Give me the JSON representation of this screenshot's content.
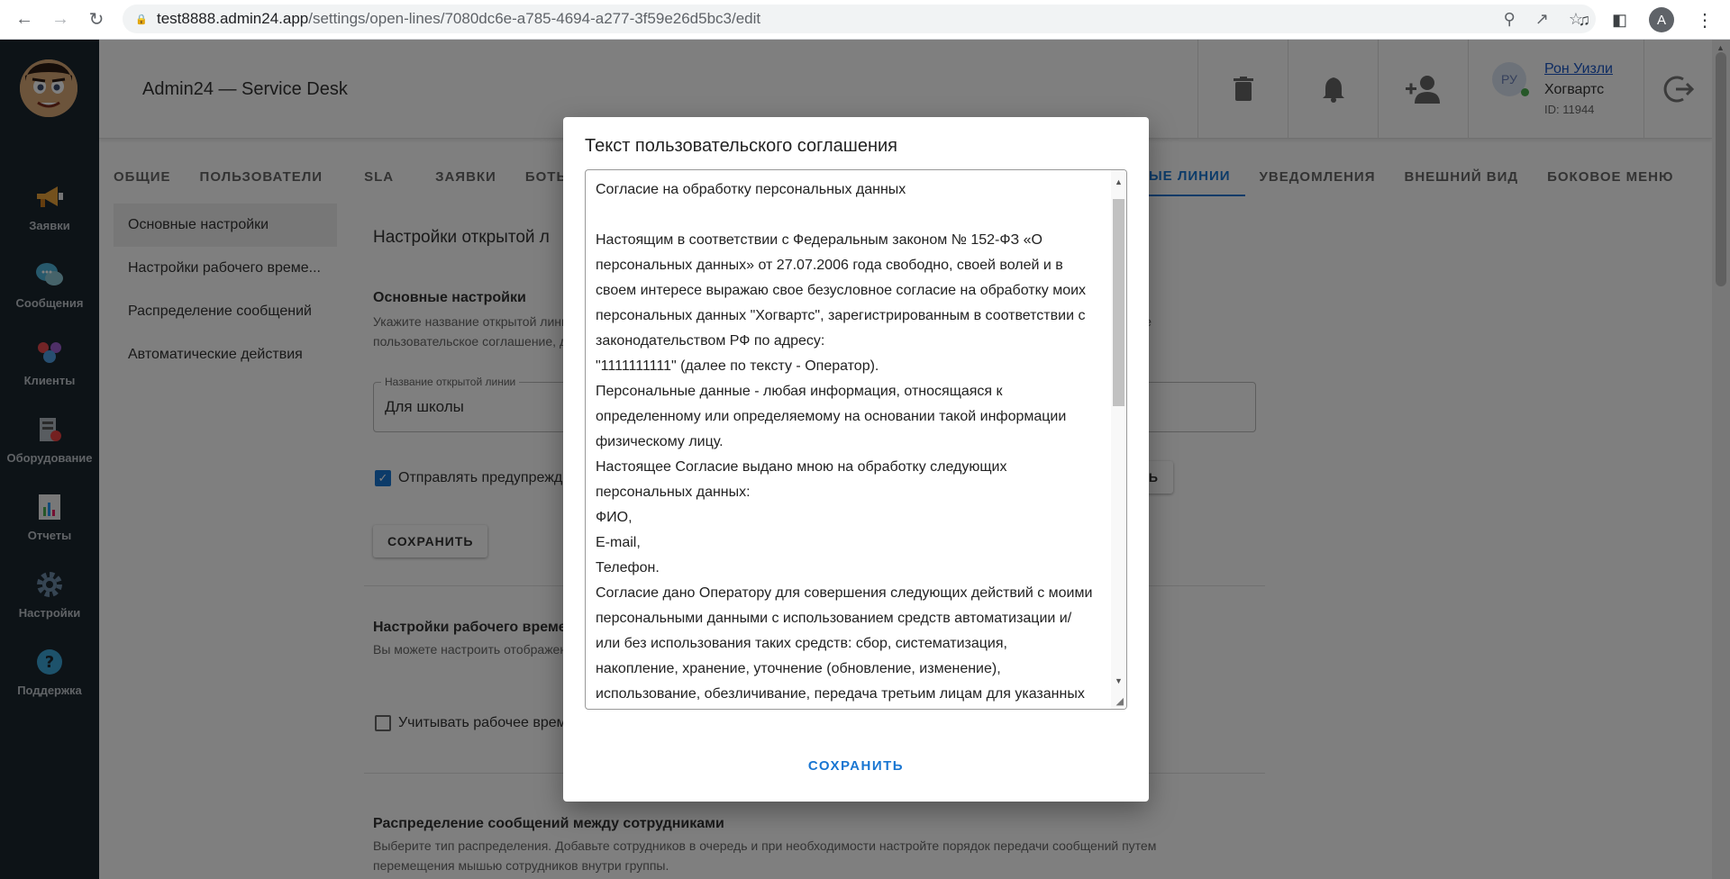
{
  "browser": {
    "url_host": "test8888.admin24.app",
    "url_path": "/settings/open-lines/7080dc6e-a785-4694-a277-3f59e26d5bc3/edit",
    "profile_initial": "A"
  },
  "sidebar": {
    "items": [
      {
        "label": "Заявки",
        "icon": "megaphone-icon"
      },
      {
        "label": "Сообщения",
        "icon": "chat-icon"
      },
      {
        "label": "Клиенты",
        "icon": "clients-icon"
      },
      {
        "label": "Оборудование",
        "icon": "equipment-icon"
      },
      {
        "label": "Отчеты",
        "icon": "reports-icon"
      },
      {
        "label": "Настройки",
        "icon": "gear-icon"
      },
      {
        "label": "Поддержка",
        "icon": "help-icon"
      }
    ]
  },
  "header": {
    "title": "Admin24 — Service Desk",
    "user": {
      "initials": "РУ",
      "name": "Рон Уизли",
      "org": "Хогвартс",
      "id": "ID: 11944"
    }
  },
  "tabs": [
    {
      "label": "ОБЩИЕ",
      "active": false
    },
    {
      "label": "ПОЛЬЗОВАТЕЛИ",
      "active": false
    },
    {
      "label": "SLA",
      "active": false
    },
    {
      "label": "ЗАЯВКИ",
      "active": false
    },
    {
      "label": "БОТЫ",
      "active": false
    },
    {
      "label": "",
      "active": false
    },
    {
      "label": "ОТКРЫТЫЕ ЛИНИИ",
      "active": true
    },
    {
      "label": "УВЕДОМЛЕНИЯ",
      "active": false
    },
    {
      "label": "ВНЕШНИЙ ВИД",
      "active": false
    },
    {
      "label": "БОКОВОЕ МЕНЮ",
      "active": false
    }
  ],
  "subnav": [
    {
      "label": "Основные настройки",
      "active": true
    },
    {
      "label": "Настройки рабочего време...",
      "active": false
    },
    {
      "label": "Распределение сообщений",
      "active": false
    },
    {
      "label": "Автоматические действия",
      "active": false
    }
  ],
  "content": {
    "section_title": "Настройки открытой л",
    "basic_title": "Основные настройки",
    "basic_desc_1": "Укажите название открытой лини",
    "basic_desc_1_tail": "те",
    "basic_desc_2": "пользовательское соглашение, д",
    "field_label": "Название открытой линии",
    "field_value": "Для школы",
    "checkbox_label": "Отправлять предупрежде",
    "configure_button": "НАСТРОИТЬ",
    "save_button": "СОХРАНИТЬ",
    "worktime_title": "Настройки рабочего време",
    "worktime_desc": "Вы можете настроить отображен",
    "worktime_checkbox": "Учитывать рабочее время",
    "dist_title": "Распределение сообщений между сотрудниками",
    "dist_desc_1": "Выберите тип распределения. Добавьте сотрудников в очередь и при необходимости настройте порядок передачи сообщений путем",
    "dist_desc_2": "перемещения мышью сотрудников внутри группы."
  },
  "dialog": {
    "title": "Текст пользовательского соглашения",
    "lines": [
      "Согласие на обработку персональных данных",
      "",
      "Настоящим в соответствии с Федеральным законом № 152-ФЗ «О",
      "персональных данных» от 27.07.2006 года свободно, своей волей и в",
      "своем интересе выражаю свое безусловное согласие на обработку моих",
      "персональных данных \"Хогвартс\", зарегистрированным в соответствии с",
      "законодательством РФ по адресу:",
      "\"1111111111\" (далее по тексту - Оператор).",
      "Персональные данные - любая информация, относящаяся к",
      "определенному или определяемому на основании такой информации",
      "физическому лицу.",
      "Настоящее Согласие выдано мною на обработку следующих",
      "персональных данных:",
      "ФИО,",
      "E-mail,",
      "Телефон.",
      "Согласие дано Оператору для совершения следующих действий с моими",
      "персональными данными с использованием средств автоматизации и/",
      "или без использования таких средств: сбор, систематизация,",
      "накопление, хранение, уточнение (обновление, изменение),",
      "использование, обезличивание, передача третьим лицам для указанных"
    ],
    "save_button": "СОХРАНИТЬ"
  }
}
